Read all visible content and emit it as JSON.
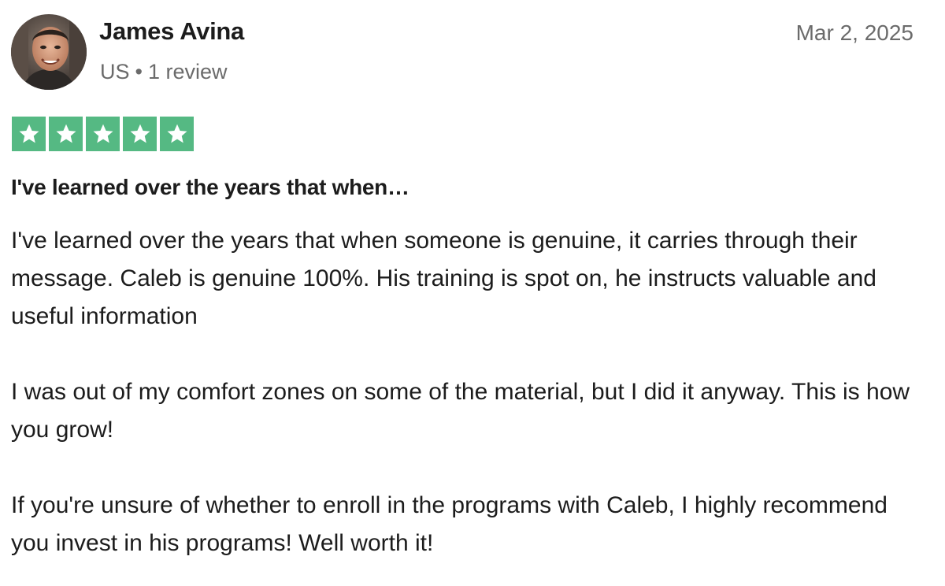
{
  "reviewer": {
    "name": "James Avina",
    "country": "US",
    "separator": "•",
    "review_count": "1 review"
  },
  "review": {
    "date": "Mar 2, 2025",
    "rating": 5,
    "title": "I've learned over the years that when…",
    "paragraphs": [
      "I've learned over the years that when someone is genuine, it carries through their message. Caleb is genuine 100%. His training is spot on, he instructs valuable and useful information",
      "I was out of my comfort zones on some of the material, but I did it anyway. This is how you grow!",
      "If you're unsure of whether to enroll in the programs with Caleb, I highly recommend you invest in his programs! Well worth it!"
    ]
  },
  "icons": {
    "avatar": "avatar-photo",
    "star": "star-icon"
  },
  "colors": {
    "star_green": "#55b983",
    "meta_gray": "#6b6b6b",
    "text": "#1c1c1c"
  }
}
